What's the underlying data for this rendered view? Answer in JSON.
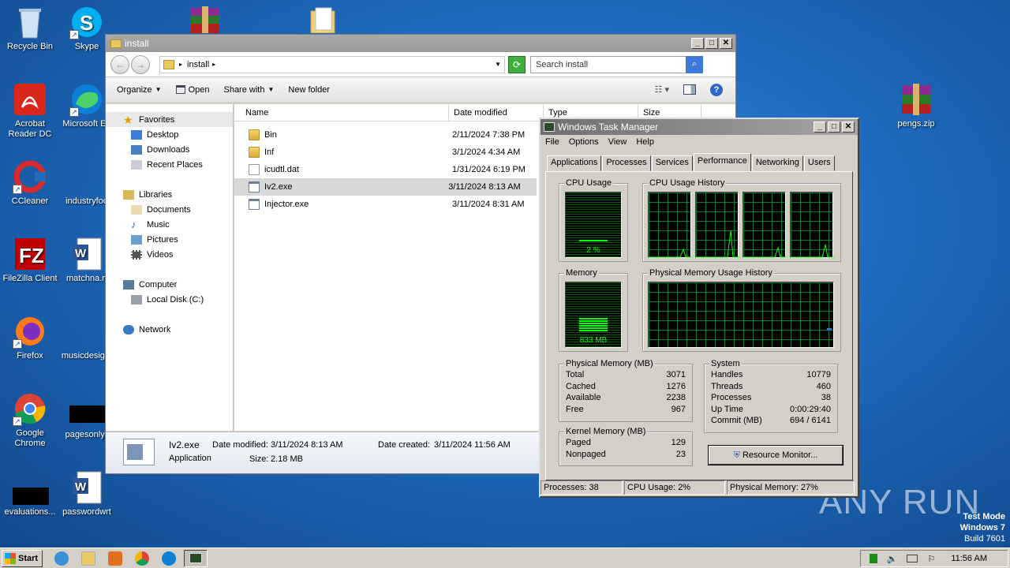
{
  "desktop": {
    "icons_left": [
      {
        "label": "Recycle Bin",
        "icon": "recycle-bin-icon"
      },
      {
        "label": "Acrobat Reader DC",
        "icon": "acrobat-icon"
      },
      {
        "label": "CCleaner",
        "icon": "ccleaner-icon"
      },
      {
        "label": "FileZilla Client",
        "icon": "filezilla-icon"
      },
      {
        "label": "Firefox",
        "icon": "firefox-icon"
      },
      {
        "label": "Google Chrome",
        "icon": "chrome-icon"
      },
      {
        "label": "evaluations...",
        "icon": "black-file-icon"
      }
    ],
    "icons_second": [
      {
        "label": "Skype",
        "icon": "skype-icon"
      },
      {
        "label": "Microsoft Ed",
        "icon": "edge-icon"
      },
      {
        "label": "industryfoo",
        "icon": "blank-icon"
      },
      {
        "label": "matchna.rt",
        "icon": "word-doc-icon"
      },
      {
        "label": "musicdesig...",
        "icon": "blank-icon"
      },
      {
        "label": "pagesonly.j",
        "icon": "black-file-icon"
      },
      {
        "label": "passwordwrt",
        "icon": "word-doc-icon"
      }
    ],
    "icon_right": {
      "label": "pengs.zip",
      "icon": "winrar-icon"
    },
    "watermark": {
      "brand": "ANY RUN",
      "line1": "Test Mode",
      "line2": "Windows 7",
      "line3": "Build 7601"
    }
  },
  "explorer": {
    "title": "install",
    "address": "install",
    "search_placeholder": "Search install",
    "toolbar": {
      "organize": "Organize",
      "open": "Open",
      "share_with": "Share with",
      "new_folder": "New folder"
    },
    "nav": {
      "favorites": "Favorites",
      "desktop": "Desktop",
      "downloads": "Downloads",
      "recent": "Recent Places",
      "libraries": "Libraries",
      "documents": "Documents",
      "music": "Music",
      "pictures": "Pictures",
      "videos": "Videos",
      "computer": "Computer",
      "local_disk": "Local Disk (C:)",
      "network": "Network"
    },
    "columns": {
      "name": "Name",
      "date": "Date modified",
      "type": "Type",
      "size": "Size"
    },
    "files": [
      {
        "name": "Bin",
        "date": "2/11/2024 7:38 PM",
        "kind": "folder"
      },
      {
        "name": "Inf",
        "date": "3/1/2024 4:34 AM",
        "kind": "folder"
      },
      {
        "name": "icudtl.dat",
        "date": "1/31/2024 6:19 PM",
        "kind": "doc"
      },
      {
        "name": "Iv2.exe",
        "date": "3/11/2024 8:13 AM",
        "kind": "exe",
        "selected": true
      },
      {
        "name": "Injector.exe",
        "date": "3/11/2024 8:31 AM",
        "kind": "exe"
      }
    ],
    "details": {
      "filename": "Iv2.exe",
      "type": "Application",
      "modified_label": "Date modified:",
      "modified": "3/11/2024 8:13 AM",
      "created_label": "Date created:",
      "created": "3/11/2024 11:56 AM",
      "size_label": "Size:",
      "size": "2.18 MB"
    }
  },
  "taskmgr": {
    "title": "Windows Task Manager",
    "menu": [
      "File",
      "Options",
      "View",
      "Help"
    ],
    "tabs": [
      "Applications",
      "Processes",
      "Services",
      "Performance",
      "Networking",
      "Users"
    ],
    "active_tab": "Performance",
    "cpu_usage_label": "CPU Usage",
    "cpu_value": "2 %",
    "cpu_fraction": 0.02,
    "cpu_history_label": "CPU Usage History",
    "memory_label": "Memory",
    "memory_value": "833 MB",
    "memory_fraction": 0.27,
    "mem_history_label": "Physical Memory Usage History",
    "physical": {
      "label": "Physical Memory (MB)",
      "rows": [
        {
          "k": "Total",
          "v": "3071"
        },
        {
          "k": "Cached",
          "v": "1276"
        },
        {
          "k": "Available",
          "v": "2238"
        },
        {
          "k": "Free",
          "v": "967"
        }
      ]
    },
    "kernel": {
      "label": "Kernel Memory (MB)",
      "rows": [
        {
          "k": "Paged",
          "v": "129"
        },
        {
          "k": "Nonpaged",
          "v": "23"
        }
      ]
    },
    "system": {
      "label": "System",
      "rows": [
        {
          "k": "Handles",
          "v": "10779"
        },
        {
          "k": "Threads",
          "v": "460"
        },
        {
          "k": "Processes",
          "v": "38"
        },
        {
          "k": "Up Time",
          "v": "0:00:29:40"
        },
        {
          "k": "Commit (MB)",
          "v": "694 / 6141"
        }
      ]
    },
    "resource_monitor": "Resource Monitor...",
    "status": {
      "processes": "Processes: 38",
      "cpu": "CPU Usage: 2%",
      "memory": "Physical Memory: 27%"
    }
  },
  "taskbar": {
    "start": "Start",
    "clock": "11:56 AM"
  }
}
